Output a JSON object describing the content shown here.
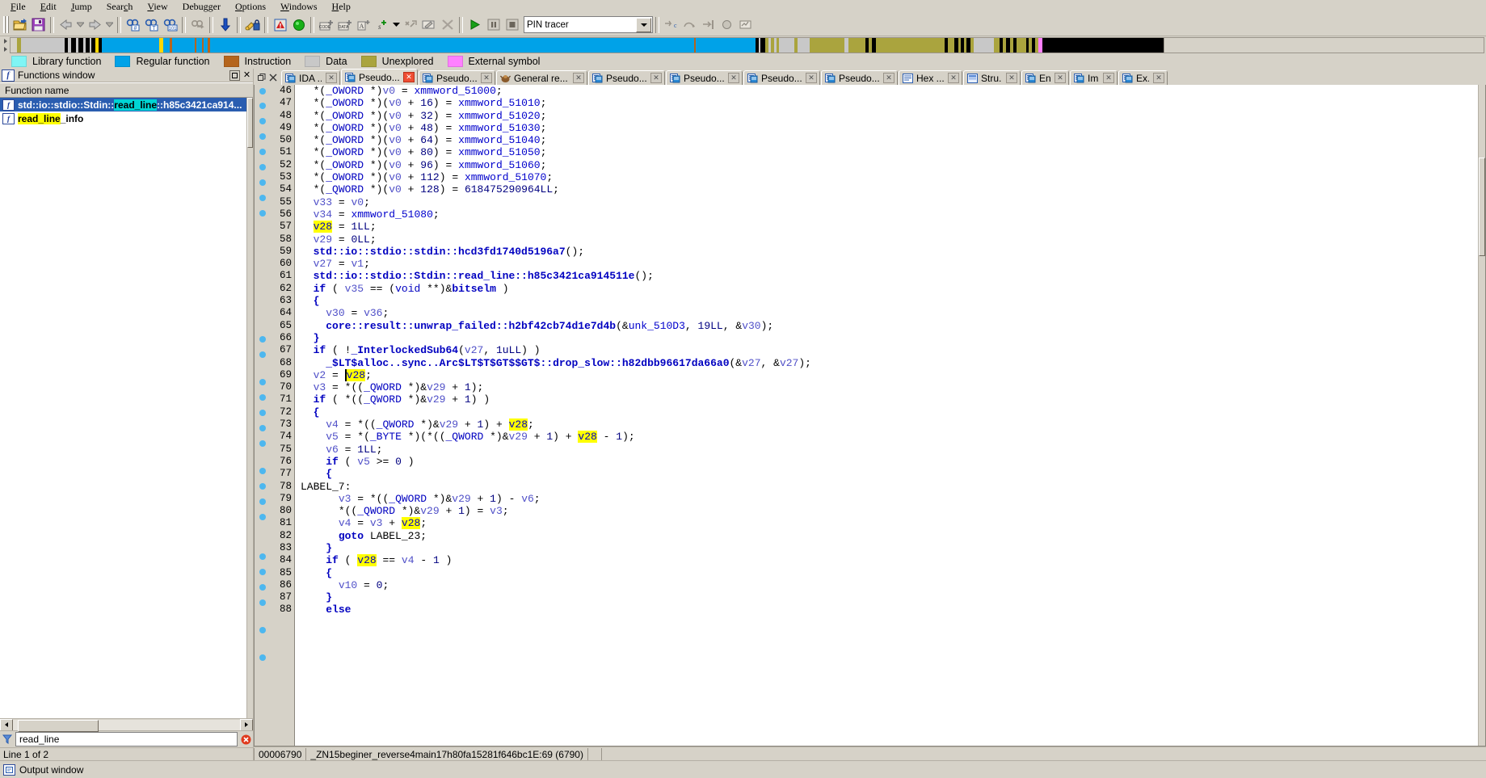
{
  "menu": {
    "items": [
      {
        "label": "File",
        "accel": "F"
      },
      {
        "label": "Edit",
        "accel": "E"
      },
      {
        "label": "Jump",
        "accel": "J"
      },
      {
        "label": "Search",
        "accel": "c"
      },
      {
        "label": "View",
        "accel": "V"
      },
      {
        "label": "Debugger",
        "accel": "g"
      },
      {
        "label": "Options",
        "accel": "O"
      },
      {
        "label": "Windows",
        "accel": "W"
      },
      {
        "label": "Help",
        "accel": "H"
      }
    ]
  },
  "toolbar": {
    "icons": [
      "open-file-icon",
      "save-icon",
      "back-arrow-icon",
      "back-dropdown-icon",
      "forward-arrow-icon",
      "forward-dropdown-icon",
      "search-hash-icon",
      "search-text-icon",
      "search-binary-icon",
      "search-again-icon",
      "jump-down-icon",
      "key-lock-icon",
      "warning-icon",
      "run-green-icon",
      "make-code-icon",
      "make-data-icon",
      "make-ascii-icon",
      "make-struct-icon",
      "struct-dropdown-icon",
      "undefine-icon",
      "rename-icon",
      "delete-icon",
      "run-debugger-icon",
      "pause-icon",
      "stop-icon"
    ],
    "debugger_combo_value": "PIN tracer",
    "debugger_combo_placeholder": "",
    "trailing_icons": [
      "step-into-icon",
      "step-over-icon",
      "run-to-cursor-icon",
      "breakpoint-icon",
      "watch-icon"
    ]
  },
  "navband": {
    "segments": [
      {
        "color": "#d6d2c8",
        "width_pct": 0.6
      },
      {
        "color": "#aaa43e",
        "width_pct": 0.35
      },
      {
        "color": "#c8c8c8",
        "width_pct": 4.0
      },
      {
        "color": "#000000",
        "width_pct": 0.3
      },
      {
        "color": "#c8c8c8",
        "width_pct": 0.25
      },
      {
        "color": "#000000",
        "width_pct": 0.45
      },
      {
        "color": "#c8c8c8",
        "width_pct": 0.2
      },
      {
        "color": "#000000",
        "width_pct": 0.5
      },
      {
        "color": "#c8c8c8",
        "width_pct": 0.2
      },
      {
        "color": "#000000",
        "width_pct": 0.35
      },
      {
        "color": "#c8c8c8",
        "width_pct": 0.15
      },
      {
        "color": "#000000",
        "width_pct": 0.4
      },
      {
        "color": "#ffd700",
        "width_pct": 0.25
      },
      {
        "color": "#000000",
        "width_pct": 0.3
      },
      {
        "color": "#00a2e8",
        "width_pct": 6.2
      },
      {
        "color": "#b5651d",
        "width_pct": 0.18
      },
      {
        "color": "#00a2e8",
        "width_pct": 2.1
      },
      {
        "color": "#b5651d",
        "width_pct": 0.16
      },
      {
        "color": "#00a2e8",
        "width_pct": 0.5
      },
      {
        "color": "#b5651d",
        "width_pct": 0.16
      },
      {
        "color": "#00a2e8",
        "width_pct": 0.35
      },
      {
        "color": "#b5651d",
        "width_pct": 0.2
      },
      {
        "color": "#00a2e8",
        "width_pct": 44.0
      },
      {
        "color": "#b5651d",
        "width_pct": 0.18
      },
      {
        "color": "#00a2e8",
        "width_pct": 5.4
      },
      {
        "color": "#000000",
        "width_pct": 0.3
      },
      {
        "color": "#c8c8c8",
        "width_pct": 0.2
      },
      {
        "color": "#000000",
        "width_pct": 0.45
      },
      {
        "color": "#aaa43e",
        "width_pct": 0.25
      },
      {
        "color": "#c8c8c8",
        "width_pct": 0.2
      },
      {
        "color": "#aaa43e",
        "width_pct": 0.3
      },
      {
        "color": "#c8c8c8",
        "width_pct": 0.25
      },
      {
        "color": "#aaa43e",
        "width_pct": 0.2
      },
      {
        "color": "#c8c8c8",
        "width_pct": 1.4
      },
      {
        "color": "#aaa43e",
        "width_pct": 0.3
      },
      {
        "color": "#c8c8c8",
        "width_pct": 1.1
      },
      {
        "color": "#aaa43e",
        "width_pct": 3.2
      },
      {
        "color": "#c8c8c8",
        "width_pct": 0.35
      },
      {
        "color": "#aaa43e",
        "width_pct": 1.5
      },
      {
        "color": "#000000",
        "width_pct": 0.35
      },
      {
        "color": "#aaa43e",
        "width_pct": 0.3
      },
      {
        "color": "#000000",
        "width_pct": 0.35
      },
      {
        "color": "#aaa43e",
        "width_pct": 6.2
      },
      {
        "color": "#000000",
        "width_pct": 0.35
      },
      {
        "color": "#aaa43e",
        "width_pct": 0.6
      },
      {
        "color": "#000000",
        "width_pct": 0.3
      },
      {
        "color": "#aaa43e",
        "width_pct": 0.25
      },
      {
        "color": "#000000",
        "width_pct": 0.3
      },
      {
        "color": "#aaa43e",
        "width_pct": 0.25
      },
      {
        "color": "#000000",
        "width_pct": 0.3
      },
      {
        "color": "#aaa43e",
        "width_pct": 0.3
      },
      {
        "color": "#c8c8c8",
        "width_pct": 1.9
      },
      {
        "color": "#aaa43e",
        "width_pct": 0.5
      },
      {
        "color": "#000000",
        "width_pct": 0.3
      },
      {
        "color": "#aaa43e",
        "width_pct": 0.3
      },
      {
        "color": "#000000",
        "width_pct": 0.3
      },
      {
        "color": "#aaa43e",
        "width_pct": 0.3
      },
      {
        "color": "#000000",
        "width_pct": 0.3
      },
      {
        "color": "#aaa43e",
        "width_pct": 0.9
      },
      {
        "color": "#000000",
        "width_pct": 0.25
      },
      {
        "color": "#aaa43e",
        "width_pct": 0.3
      },
      {
        "color": "#000000",
        "width_pct": 0.25
      },
      {
        "color": "#aaa43e",
        "width_pct": 0.3
      },
      {
        "color": "#ff80ff",
        "width_pct": 0.4
      },
      {
        "color": "#000000",
        "width_pct": 11.0
      }
    ]
  },
  "legend": {
    "items": [
      {
        "label": "Library function",
        "color": "#7ff5f5"
      },
      {
        "label": "Regular function",
        "color": "#00a2e8"
      },
      {
        "label": "Instruction",
        "color": "#b5651d"
      },
      {
        "label": "Data",
        "color": "#c8c8c8"
      },
      {
        "label": "Unexplored",
        "color": "#aaa43e"
      },
      {
        "label": "External symbol",
        "color": "#ff80ff"
      }
    ]
  },
  "functions_window": {
    "title": "Functions window",
    "column_header": "Function name",
    "rows": [
      {
        "prefix": "std::io::stdio::Stdin::",
        "highlight": "read_line",
        "suffix": "::h85c3421ca914...",
        "selected": true
      },
      {
        "prefix": "",
        "highlight": "read_line",
        "suffix": "_info",
        "selected": false
      }
    ],
    "filter_value": "read_line",
    "line_info": "Line 1 of 2"
  },
  "tabs": [
    {
      "label": "IDA ...",
      "icon": "pseudocode-icon",
      "active": false,
      "close": "gray"
    },
    {
      "label": "Pseudo...",
      "icon": "pseudocode-icon",
      "active": true,
      "close": "red"
    },
    {
      "label": "Pseudo...",
      "icon": "pseudocode-icon",
      "active": false,
      "close": "gray"
    },
    {
      "label": "General re...",
      "icon": "registers-icon",
      "active": false,
      "close": "gray"
    },
    {
      "label": "Pseudo...",
      "icon": "pseudocode-icon",
      "active": false,
      "close": "gray"
    },
    {
      "label": "Pseudo...",
      "icon": "pseudocode-icon",
      "active": false,
      "close": "gray"
    },
    {
      "label": "Pseudo...",
      "icon": "pseudocode-icon",
      "active": false,
      "close": "gray"
    },
    {
      "label": "Pseudo...",
      "icon": "pseudocode-icon",
      "active": false,
      "close": "gray"
    },
    {
      "label": "Hex ...",
      "icon": "hexview-icon",
      "active": false,
      "close": "gray"
    },
    {
      "label": "Stru...",
      "icon": "structures-icon",
      "active": false,
      "close": "gray"
    },
    {
      "label": "En...",
      "icon": "enums-icon",
      "active": false,
      "close": "gray"
    },
    {
      "label": "Im...",
      "icon": "imports-icon",
      "active": false,
      "close": "gray"
    },
    {
      "label": "Ex...",
      "icon": "exports-icon",
      "active": false,
      "close": "gray"
    }
  ],
  "code": {
    "first_line": 46,
    "lines": [
      {
        "n": 46,
        "bp": true,
        "html": "  <span class='pn'>*(</span><span class='ty'>_OWORD </span><span class='pn'>*)</span><span class='va'>v0</span> <span class='pn'>=</span> <span class='gl'>xmmword_51000</span><span class='pn'>;</span>"
      },
      {
        "n": 47,
        "bp": true,
        "html": "  <span class='pn'>*(</span><span class='ty'>_OWORD </span><span class='pn'>*)(</span><span class='va'>v0</span> <span class='pn'>+</span> <span class='num'>16</span><span class='pn'>)</span> <span class='pn'>=</span> <span class='gl'>xmmword_51010</span><span class='pn'>;</span>"
      },
      {
        "n": 48,
        "bp": true,
        "html": "  <span class='pn'>*(</span><span class='ty'>_OWORD </span><span class='pn'>*)(</span><span class='va'>v0</span> <span class='pn'>+</span> <span class='num'>32</span><span class='pn'>)</span> <span class='pn'>=</span> <span class='gl'>xmmword_51020</span><span class='pn'>;</span>"
      },
      {
        "n": 49,
        "bp": true,
        "html": "  <span class='pn'>*(</span><span class='ty'>_OWORD </span><span class='pn'>*)(</span><span class='va'>v0</span> <span class='pn'>+</span> <span class='num'>48</span><span class='pn'>)</span> <span class='pn'>=</span> <span class='gl'>xmmword_51030</span><span class='pn'>;</span>"
      },
      {
        "n": 50,
        "bp": true,
        "html": "  <span class='pn'>*(</span><span class='ty'>_OWORD </span><span class='pn'>*)(</span><span class='va'>v0</span> <span class='pn'>+</span> <span class='num'>64</span><span class='pn'>)</span> <span class='pn'>=</span> <span class='gl'>xmmword_51040</span><span class='pn'>;</span>"
      },
      {
        "n": 51,
        "bp": true,
        "html": "  <span class='pn'>*(</span><span class='ty'>_OWORD </span><span class='pn'>*)(</span><span class='va'>v0</span> <span class='pn'>+</span> <span class='num'>80</span><span class='pn'>)</span> <span class='pn'>=</span> <span class='gl'>xmmword_51050</span><span class='pn'>;</span>"
      },
      {
        "n": 52,
        "bp": true,
        "html": "  <span class='pn'>*(</span><span class='ty'>_OWORD </span><span class='pn'>*)(</span><span class='va'>v0</span> <span class='pn'>+</span> <span class='num'>96</span><span class='pn'>)</span> <span class='pn'>=</span> <span class='gl'>xmmword_51060</span><span class='pn'>;</span>"
      },
      {
        "n": 53,
        "bp": true,
        "html": "  <span class='pn'>*(</span><span class='ty'>_OWORD </span><span class='pn'>*)(</span><span class='va'>v0</span> <span class='pn'>+</span> <span class='num'>112</span><span class='pn'>)</span> <span class='pn'>=</span> <span class='gl'>xmmword_51070</span><span class='pn'>;</span>"
      },
      {
        "n": 54,
        "bp": true,
        "html": "  <span class='pn'>*(</span><span class='ty'>_QWORD </span><span class='pn'>*)(</span><span class='va'>v0</span> <span class='pn'>+</span> <span class='num'>128</span><span class='pn'>)</span> <span class='pn'>=</span> <span class='num'>618475290964LL</span><span class='pn'>;</span>"
      },
      {
        "n": 55,
        "bp": false,
        "html": "  <span class='va'>v33</span> <span class='pn'>=</span> <span class='va'>v0</span><span class='pn'>;</span>"
      },
      {
        "n": 56,
        "bp": false,
        "html": "  <span class='va'>v34</span> <span class='pn'>=</span> <span class='gl'>xmmword_51080</span><span class='pn'>;</span>"
      },
      {
        "n": 57,
        "bp": false,
        "html": "  <span class='hlv'>v28</span> <span class='pn'>=</span> <span class='num'>1LL</span><span class='pn'>;</span>"
      },
      {
        "n": 58,
        "bp": false,
        "html": "  <span class='va'>v29</span> <span class='pn'>=</span> <span class='num'>0LL</span><span class='pn'>;</span>"
      },
      {
        "n": 59,
        "bp": false,
        "html": "  <span class='kw'>std::io::stdio::stdin::hcd3fd1740d5196a7</span><span class='pn'>();</span>"
      },
      {
        "n": 60,
        "bp": false,
        "html": "  <span class='va'>v27</span> <span class='pn'>=</span> <span class='va'>v1</span><span class='pn'>;</span>"
      },
      {
        "n": 61,
        "bp": false,
        "html": "  <span class='kw'>std::io::stdio::Stdin::read_line::h85c3421ca914511e</span><span class='pn'>();</span>"
      },
      {
        "n": 62,
        "bp": false,
        "html": "  <span class='kw'>if</span> <span class='pn'>(</span> <span class='va'>v35</span> <span class='pn'>==</span> <span class='pn'>(</span><span class='ty'>void </span><span class='pn'>**)&amp;</span><span class='kw'>bitselm</span> <span class='pn'>)</span>"
      },
      {
        "n": 63,
        "bp": false,
        "html": "  <span class='kw'>{</span>"
      },
      {
        "n": 64,
        "bp": true,
        "html": "    <span class='va'>v30</span> <span class='pn'>=</span> <span class='va'>v36</span><span class='pn'>;</span>"
      },
      {
        "n": 65,
        "bp": true,
        "html": "    <span class='kw'>core::result::unwrap_failed::h2bf42cb74d1e7d4b</span><span class='pn'>(&amp;</span><span class='gl'>unk_510D3</span><span class='pn'>,</span> <span class='num'>19LL</span><span class='pn'>,</span> <span class='pn'>&amp;</span><span class='va'>v30</span><span class='pn'>);</span>"
      },
      {
        "n": 66,
        "bp": false,
        "html": "  <span class='kw'>}</span>"
      },
      {
        "n": 67,
        "bp": true,
        "html": "  <span class='kw'>if</span> <span class='pn'>(</span> <span class='pn'>!</span><span class='kw'>_InterlockedSub64</span><span class='pn'>(</span><span class='va'>v27</span><span class='pn'>,</span> <span class='num'>1uLL</span><span class='pn'>)</span> <span class='pn'>)</span>"
      },
      {
        "n": 68,
        "bp": true,
        "html": "    <span class='kw'>_$LT$alloc..sync..Arc$LT$T$GT$$GT$::drop_slow::h82dbb96617da66a0</span><span class='pn'>(&amp;</span><span class='va'>v27</span><span class='pn'>,</span> <span class='pn'>&amp;</span><span class='va'>v27</span><span class='pn'>);</span>"
      },
      {
        "n": 69,
        "bp": true,
        "html": "  <span class='va'>v2</span> <span class='pn'>=</span> <span class='cursorv'>v28</span><span class='pn'>;</span>"
      },
      {
        "n": 70,
        "bp": true,
        "html": "  <span class='va'>v3</span> <span class='pn'>=</span> <span class='pn'>*((</span><span class='ty'>_QWORD </span><span class='pn'>*)&amp;</span><span class='va'>v29</span> <span class='pn'>+</span> <span class='num'>1</span><span class='pn'>);</span>"
      },
      {
        "n": 71,
        "bp": true,
        "html": "  <span class='kw'>if</span> <span class='pn'>(</span> <span class='pn'>*((</span><span class='ty'>_QWORD </span><span class='pn'>*)&amp;</span><span class='va'>v29</span> <span class='pn'>+</span> <span class='num'>1</span><span class='pn'>)</span> <span class='pn'>)</span>"
      },
      {
        "n": 72,
        "bp": false,
        "html": "  <span class='kw'>{</span>"
      },
      {
        "n": 73,
        "bp": true,
        "html": "    <span class='va'>v4</span> <span class='pn'>=</span> <span class='pn'>*((</span><span class='ty'>_QWORD </span><span class='pn'>*)&amp;</span><span class='va'>v29</span> <span class='pn'>+</span> <span class='num'>1</span><span class='pn'>)</span> <span class='pn'>+</span> <span class='hlv'>v28</span><span class='pn'>;</span>"
      },
      {
        "n": 74,
        "bp": true,
        "html": "    <span class='va'>v5</span> <span class='pn'>=</span> <span class='pn'>*(</span><span class='ty'>_BYTE </span><span class='pn'>*)(*((</span><span class='ty'>_QWORD </span><span class='pn'>*)&amp;</span><span class='va'>v29</span> <span class='pn'>+</span> <span class='num'>1</span><span class='pn'>)</span> <span class='pn'>+</span> <span class='hlv'>v28</span> <span class='pn'>-</span> <span class='num'>1</span><span class='pn'>);</span>"
      },
      {
        "n": 75,
        "bp": true,
        "html": "    <span class='va'>v6</span> <span class='pn'>=</span> <span class='num'>1LL</span><span class='pn'>;</span>"
      },
      {
        "n": 76,
        "bp": true,
        "html": "    <span class='kw'>if</span> <span class='pn'>(</span> <span class='va'>v5</span> <span class='pn'>&gt;=</span> <span class='num'>0</span> <span class='pn'>)</span>"
      },
      {
        "n": 77,
        "bp": false,
        "html": "    <span class='kw'>{</span>"
      },
      {
        "n": 78,
        "bp": false,
        "html": "<span class='lbl2'>LABEL_7:</span>"
      },
      {
        "n": 79,
        "bp": true,
        "html": "      <span class='va'>v3</span> <span class='pn'>=</span> <span class='pn'>*((</span><span class='ty'>_QWORD </span><span class='pn'>*)&amp;</span><span class='va'>v29</span> <span class='pn'>+</span> <span class='num'>1</span><span class='pn'>)</span> <span class='pn'>-</span> <span class='va'>v6</span><span class='pn'>;</span>"
      },
      {
        "n": 80,
        "bp": true,
        "html": "      <span class='pn'>*((</span><span class='ty'>_QWORD </span><span class='pn'>*)&amp;</span><span class='va'>v29</span> <span class='pn'>+</span> <span class='num'>1</span><span class='pn'>)</span> <span class='pn'>=</span> <span class='va'>v3</span><span class='pn'>;</span>"
      },
      {
        "n": 81,
        "bp": true,
        "html": "      <span class='va'>v4</span> <span class='pn'>=</span> <span class='va'>v3</span> <span class='pn'>+</span> <span class='hlv'>v28</span><span class='pn'>;</span>"
      },
      {
        "n": 82,
        "bp": true,
        "html": "      <span class='kw'>goto</span> <span class='lbl2'>LABEL_23</span><span class='pn'>;</span>"
      },
      {
        "n": 83,
        "bp": false,
        "html": "    <span class='kw'>}</span>"
      },
      {
        "n": 84,
        "bp": true,
        "html": "    <span class='kw'>if</span> <span class='pn'>(</span> <span class='hlv'>v28</span> <span class='pn'>==</span> <span class='va'>v4</span> <span class='pn'>-</span> <span class='num'>1</span> <span class='pn'>)</span>"
      },
      {
        "n": 85,
        "bp": false,
        "html": "    <span class='kw'>{</span>"
      },
      {
        "n": 86,
        "bp": true,
        "html": "      <span class='va'>v10</span> <span class='pn'>=</span> <span class='num'>0</span><span class='pn'>;</span>"
      },
      {
        "n": 87,
        "bp": false,
        "html": "    <span class='kw'>}</span>"
      },
      {
        "n": 88,
        "bp": false,
        "html": "    <span class='kw'>else</span>"
      }
    ]
  },
  "code_status": {
    "address": "00006790",
    "location": "_ZN15beginer_reverse4main17h80fa15281f646bc1E:69 (6790)"
  },
  "output_window": {
    "title": "Output window"
  }
}
